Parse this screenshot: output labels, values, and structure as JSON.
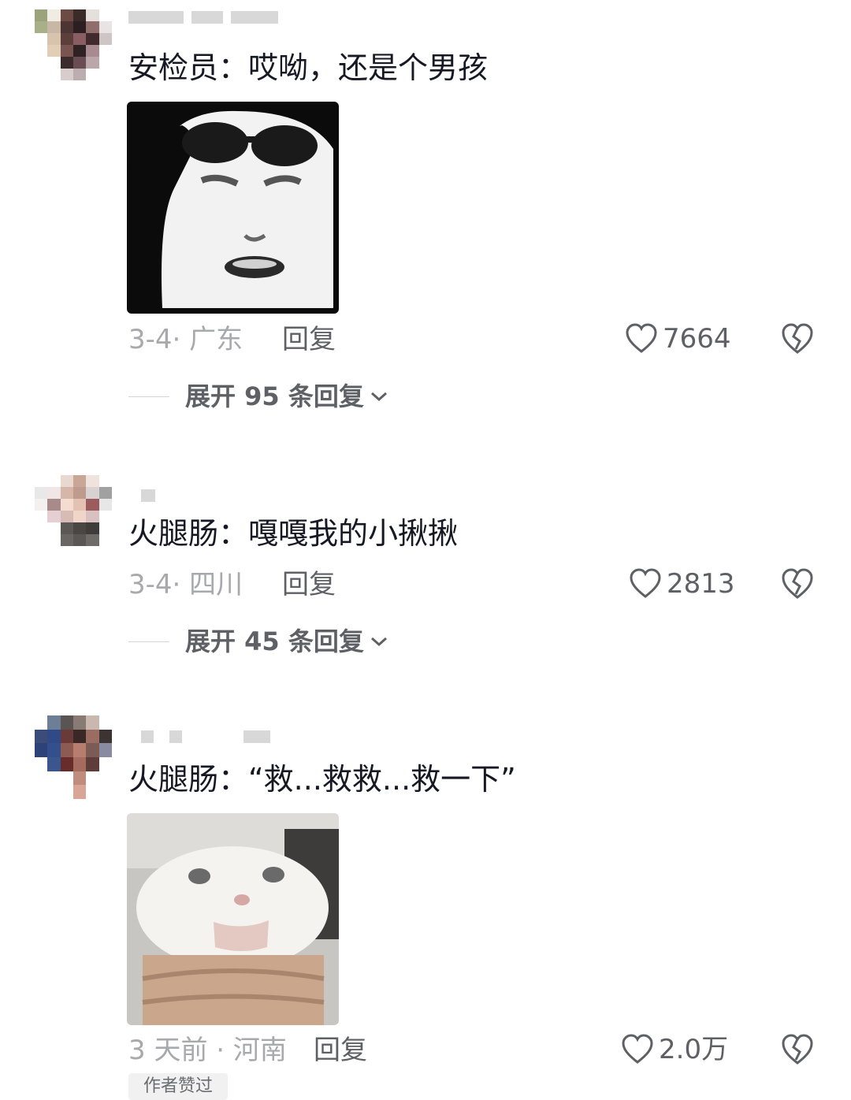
{
  "comments": [
    {
      "text": "安检员：哎呦，还是个男孩",
      "meta": "3-4· 广东",
      "reply_label": "回复",
      "likes": "7664",
      "expand_label": "展开 95 条回复",
      "sticker": "sunglasses-salute-face"
    },
    {
      "text": "火腿肠：嘎嘎我的小揪揪",
      "meta": "3-4· 四川",
      "reply_label": "回复",
      "likes": "2813",
      "expand_label": "展开 45 条回复"
    },
    {
      "text": "火腿肠：“救...救救...救一下”",
      "meta": "3 天前 · 河南",
      "reply_label": "回复",
      "likes": "2.0万",
      "sticker": "squished-white-cat",
      "author_tag": "作者赞过"
    }
  ],
  "icons": {
    "like": "heart-outline-icon",
    "dislike": "broken-heart-icon",
    "expand": "chevron-down-icon"
  },
  "colors": {
    "text_primary": "#161823",
    "text_meta": "#a8a9ad",
    "text_action": "#5f6066"
  }
}
